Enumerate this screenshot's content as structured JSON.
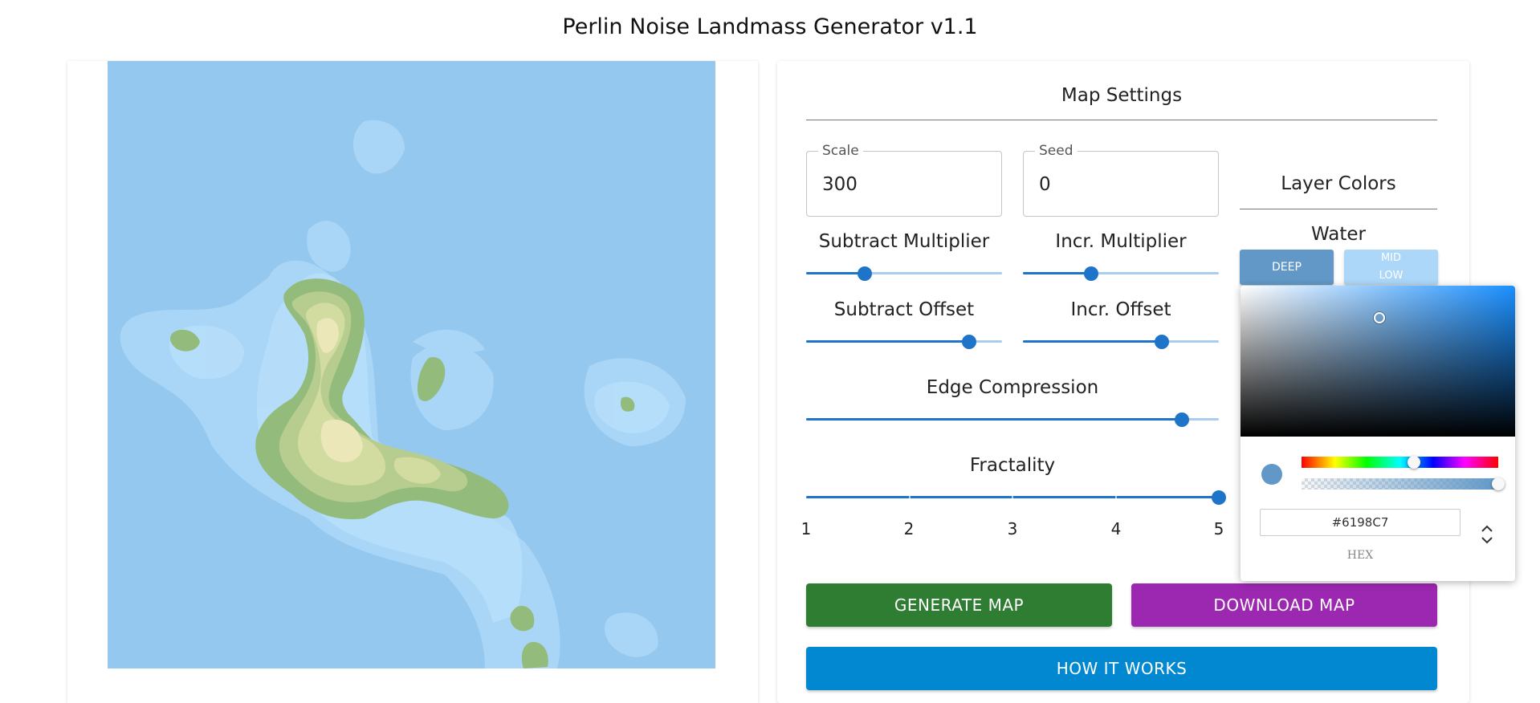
{
  "app": {
    "title": "Perlin Noise Landmass Generator v1.1"
  },
  "settings": {
    "title": "Map Settings",
    "scale": {
      "label": "Scale",
      "value": "300"
    },
    "seed": {
      "label": "Seed",
      "value": "0"
    },
    "sliders": {
      "subtract_multiplier": {
        "label": "Subtract Multiplier",
        "value": 0.3
      },
      "incr_multiplier": {
        "label": "Incr. Multiplier",
        "value": 0.35
      },
      "subtract_offset": {
        "label": "Subtract Offset",
        "value": 0.83
      },
      "incr_offset": {
        "label": "Incr. Offset",
        "value": 0.71
      },
      "edge_compression": {
        "label": "Edge Compression",
        "value": 0.91
      },
      "fractality": {
        "label": "Fractality",
        "value": 5,
        "min": 1,
        "max": 5,
        "marks": [
          "1",
          "2",
          "3",
          "4",
          "5"
        ]
      }
    },
    "buttons": {
      "generate": "GENERATE MAP",
      "download": "DOWNLOAD MAP",
      "how_it_works": "HOW IT WORKS"
    }
  },
  "layer_colors": {
    "title": "Layer Colors",
    "water": {
      "title": "Water",
      "deep_label": "DEEP",
      "mid_label": "MID",
      "low_label": "LOW"
    }
  },
  "color_picker": {
    "hex_value": "#6198C7",
    "mode_label": "HEX",
    "hue_position": 0.57,
    "alpha_position": 1.0
  },
  "colors": {
    "map_ocean": "#95c8ee",
    "deep": "#6198c7",
    "mid": "#acd7f8",
    "generate": "#2e7d32",
    "download": "#9c27b0",
    "how": "#0288d1"
  }
}
